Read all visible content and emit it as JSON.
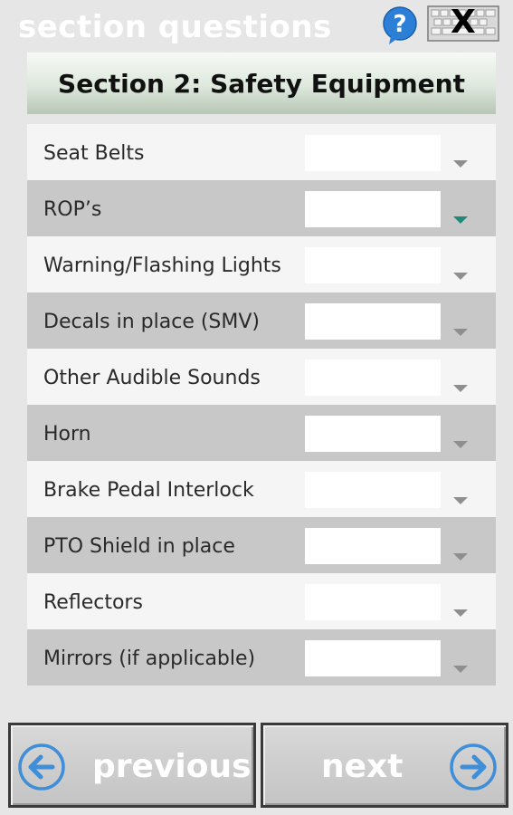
{
  "app": {
    "title": "section questions",
    "close_label": "X"
  },
  "section": {
    "title": "Section 2: Safety Equipment"
  },
  "questions": [
    {
      "label": "Seat Belts",
      "answer": ""
    },
    {
      "label": "ROP’s",
      "answer": ""
    },
    {
      "label": "Warning/Flashing Lights",
      "answer": ""
    },
    {
      "label": "Decals in place (SMV)",
      "answer": ""
    },
    {
      "label": "Other Audible Sounds",
      "answer": ""
    },
    {
      "label": "Horn",
      "answer": ""
    },
    {
      "label": "Brake Pedal Interlock",
      "answer": ""
    },
    {
      "label": "PTO Shield in place",
      "answer": ""
    },
    {
      "label": "Reflectors",
      "answer": ""
    },
    {
      "label": "Mirrors (if applicable)",
      "answer": ""
    }
  ],
  "nav": {
    "previous_label": "previous",
    "next_label": "next"
  },
  "icons": {
    "help": "help-icon",
    "keyboard": "keyboard-icon",
    "previous": "arrow-left-icon",
    "next": "arrow-right-icon"
  },
  "colors": {
    "accent_arrow": "#1e8a7a",
    "nav_circle": "#4a90d9"
  }
}
